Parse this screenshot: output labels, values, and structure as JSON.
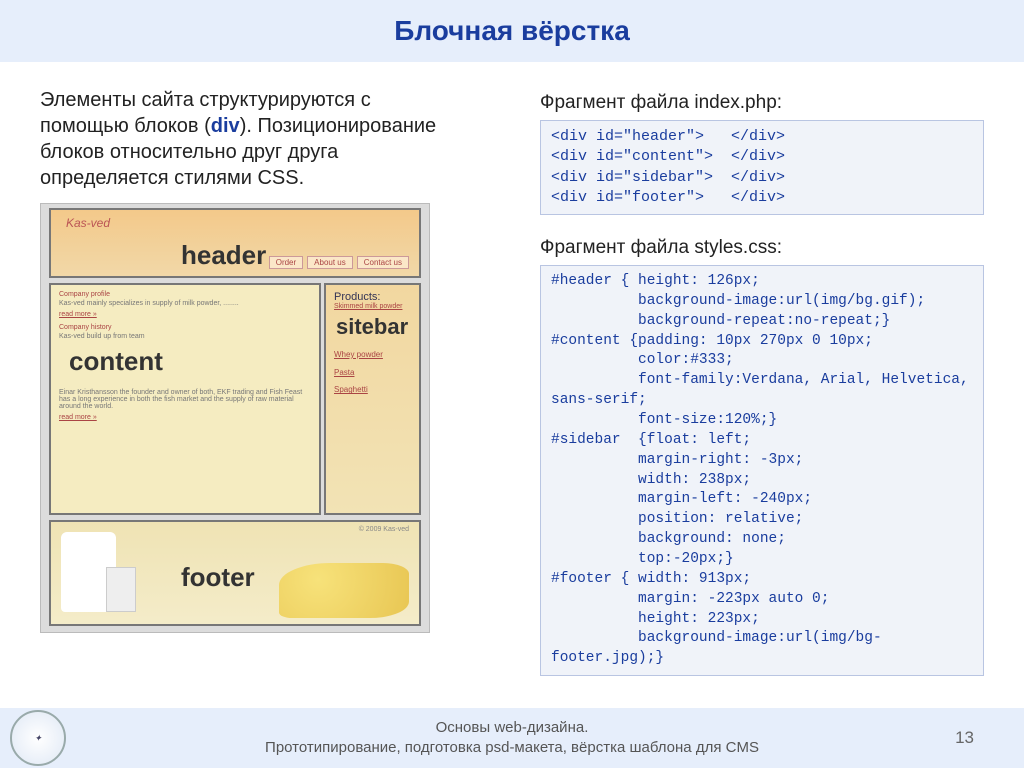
{
  "title": "Блочная вёрстка",
  "intro_pre": "Элементы сайта структурируются с помощью блоков (",
  "intro_kw": "div",
  "intro_post": "). Позиционирование блоков относительно друг друга определяется стилями CSS.",
  "mock": {
    "logo": "Kas-ved",
    "nav": [
      "Order",
      "About us",
      "Contact us"
    ],
    "header_label": "header",
    "section1_title": "Company profile",
    "section1_text": "Kas-ved mainly specializes in supply of milk powder, ........",
    "read_more": "read more »",
    "section2_title": "Company history",
    "section2_sub": "Kas-ved build up from team",
    "section2_text": "Einar Kristhansson the founder and owner of both, EKF trading and Fish Feast has a long experience in both the fish market and the supply of raw material around the world.",
    "content_label": "content",
    "products_title": "Products:",
    "sidebar_label": "sitebar",
    "products": [
      "Skimmed milk powder",
      "Whey powder",
      "Pasta",
      "Spaghetti"
    ],
    "footer_label": "footer",
    "copyright": "© 2009 Kas-ved"
  },
  "caption1": "Фрагмент файла index.php:",
  "code1": "<div id=\"header\">   </div>\n<div id=\"content\">  </div>\n<div id=\"sidebar\">  </div>\n<div id=\"footer\">   </div>",
  "caption2": "Фрагмент файла styles.css:",
  "code2": "#header { height: 126px;\n          background-image:url(img/bg.gif);\n          background-repeat:no-repeat;}\n#content {padding: 10px 270px 0 10px;\n          color:#333;\n          font-family:Verdana, Arial, Helvetica,\nsans-serif;\n          font-size:120%;}\n#sidebar  {float: left;\n          margin-right: -3px;\n          width: 238px;\n          margin-left: -240px;\n          position: relative;\n          background: none;\n          top:-20px;}\n#footer { width: 913px;\n          margin: -223px auto 0;\n          height: 223px;\n          background-image:url(img/bg-\nfooter.jpg);}",
  "footer_line1": "Основы web-дизайна.",
  "footer_line2": "Прототипирование, подготовка psd-макета, вёрстка шаблона для CMS",
  "page_number": "13"
}
